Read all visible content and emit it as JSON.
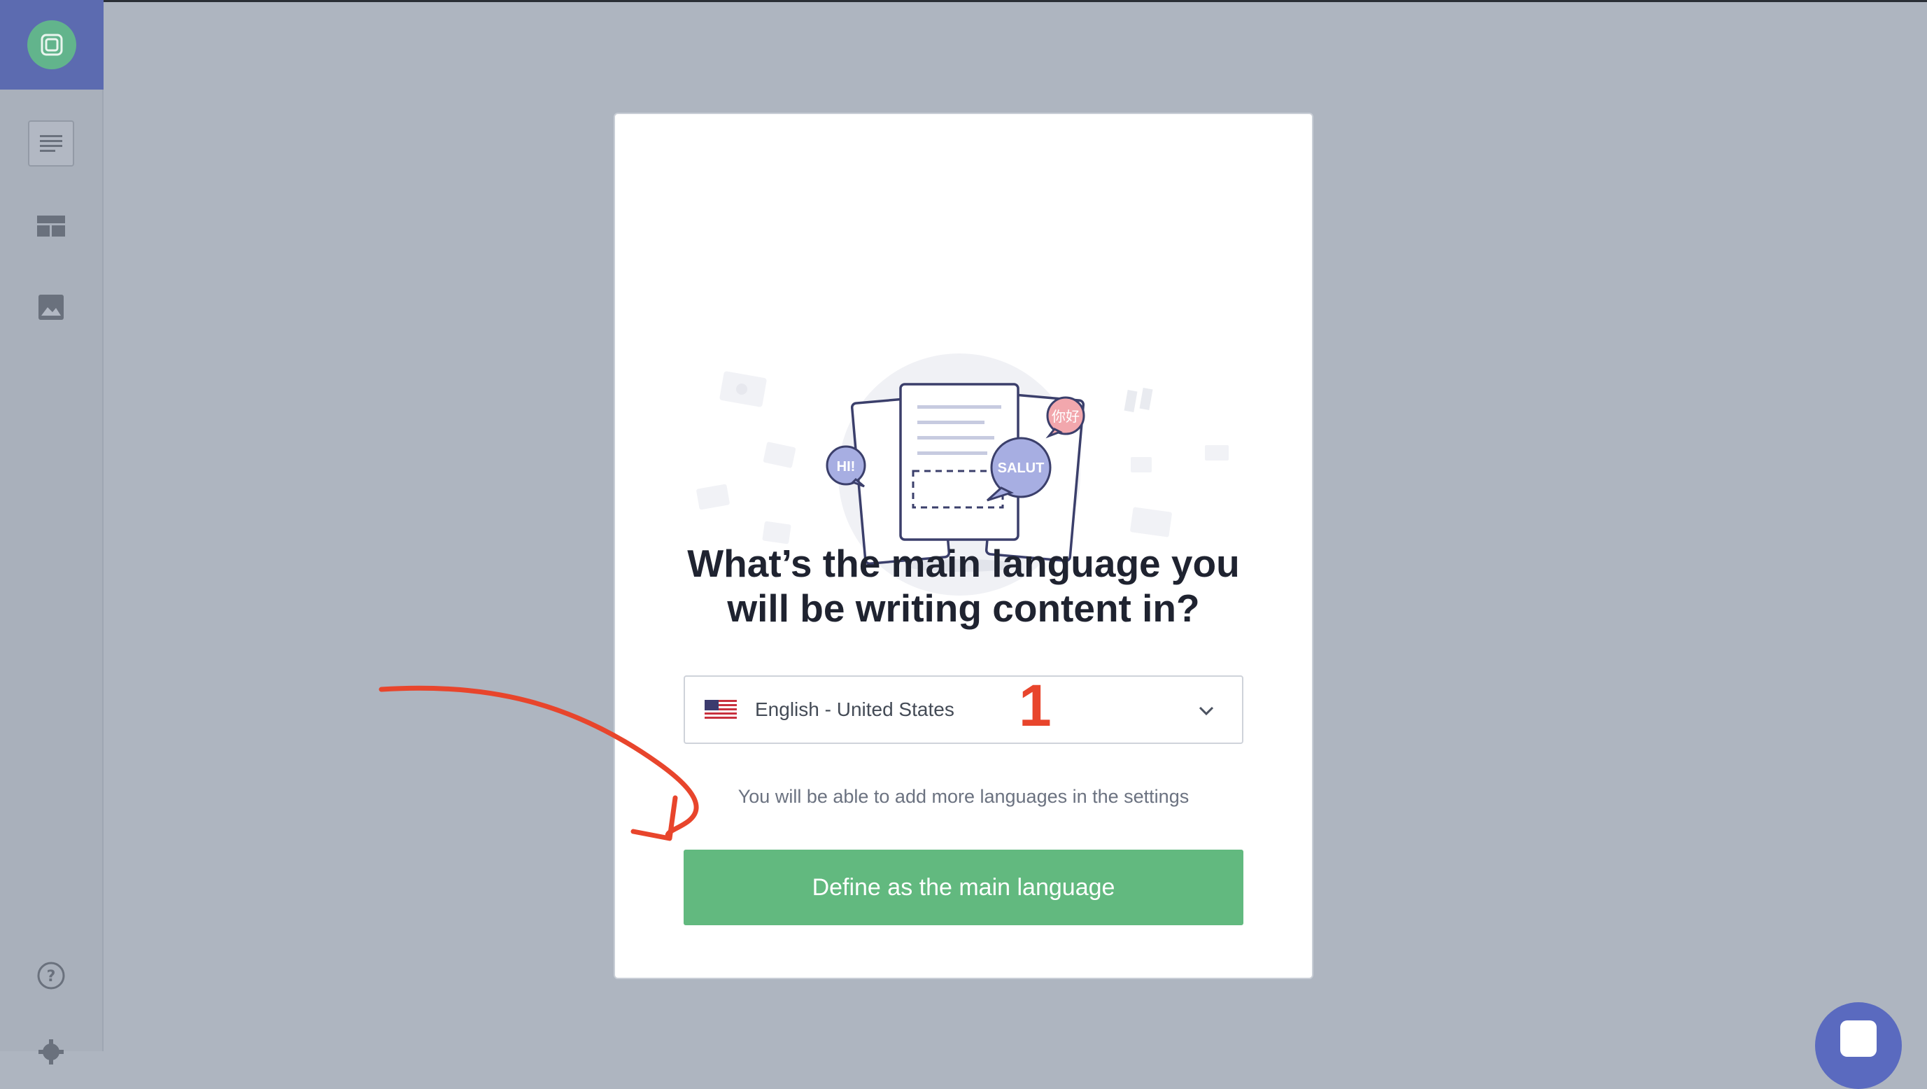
{
  "app": {
    "sidebar": {
      "logo_icon": "app-logo-icon",
      "items": [
        {
          "name": "content-list",
          "icon": "list-icon",
          "active": true
        },
        {
          "name": "layout",
          "icon": "layout-icon",
          "active": false
        },
        {
          "name": "media",
          "icon": "image-icon",
          "active": false
        }
      ],
      "bottom": [
        {
          "name": "help",
          "icon": "question-circle-icon"
        },
        {
          "name": "settings",
          "icon": "gear-icon"
        }
      ]
    }
  },
  "modal": {
    "title_line1": "What’s the main language you",
    "title_line2": "will be writing content in?",
    "language_select": {
      "value": "English - United States",
      "flag": "us-flag-icon"
    },
    "hint": "You will be able to add more languages in the settings",
    "cta_label": "Define as the main language",
    "illustration": {
      "bubble_hi": "HI!",
      "bubble_salut": "SALUT",
      "bubble_nihao": "你好"
    }
  },
  "annotation": {
    "step_number": "1",
    "color": "#e8452c"
  },
  "colors": {
    "overlay": "#aeb5c0",
    "brand": "#5c6bb0",
    "cta": "#62b97f",
    "logo": "#62b48c"
  }
}
